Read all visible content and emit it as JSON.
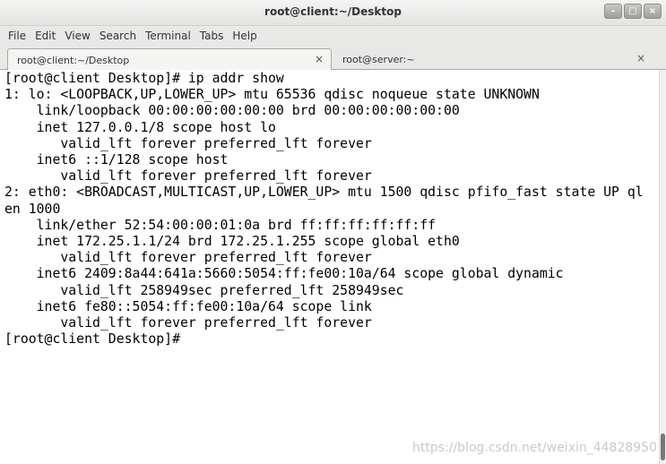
{
  "window": {
    "title": "root@client:~/Desktop",
    "minimize_glyph": "–",
    "maximize_glyph": "□",
    "close_glyph": "×"
  },
  "menu": [
    "File",
    "Edit",
    "View",
    "Search",
    "Terminal",
    "Tabs",
    "Help"
  ],
  "tabs": [
    {
      "label": "root@client:~/Desktop",
      "active": true,
      "close": "×"
    },
    {
      "label": "root@server:~",
      "active": false,
      "close": "×"
    }
  ],
  "terminal": {
    "lines": [
      "[root@client Desktop]# ip addr show",
      "1: lo: <LOOPBACK,UP,LOWER_UP> mtu 65536 qdisc noqueue state UNKNOWN",
      "    link/loopback 00:00:00:00:00:00 brd 00:00:00:00:00:00",
      "    inet 127.0.0.1/8 scope host lo",
      "       valid_lft forever preferred_lft forever",
      "    inet6 ::1/128 scope host",
      "       valid_lft forever preferred_lft forever",
      "2: eth0: <BROADCAST,MULTICAST,UP,LOWER_UP> mtu 1500 qdisc pfifo_fast state UP ql",
      "en 1000",
      "    link/ether 52:54:00:00:01:0a brd ff:ff:ff:ff:ff:ff",
      "    inet 172.25.1.1/24 brd 172.25.1.255 scope global eth0",
      "       valid_lft forever preferred_lft forever",
      "    inet6 2409:8a44:641a:5660:5054:ff:fe00:10a/64 scope global dynamic",
      "       valid_lft 258949sec preferred_lft 258949sec",
      "    inet6 fe80::5054:ff:fe00:10a/64 scope link",
      "       valid_lft forever preferred_lft forever",
      "[root@client Desktop]#"
    ]
  },
  "watermark": "https://blog.csdn.net/weixin_44828950"
}
